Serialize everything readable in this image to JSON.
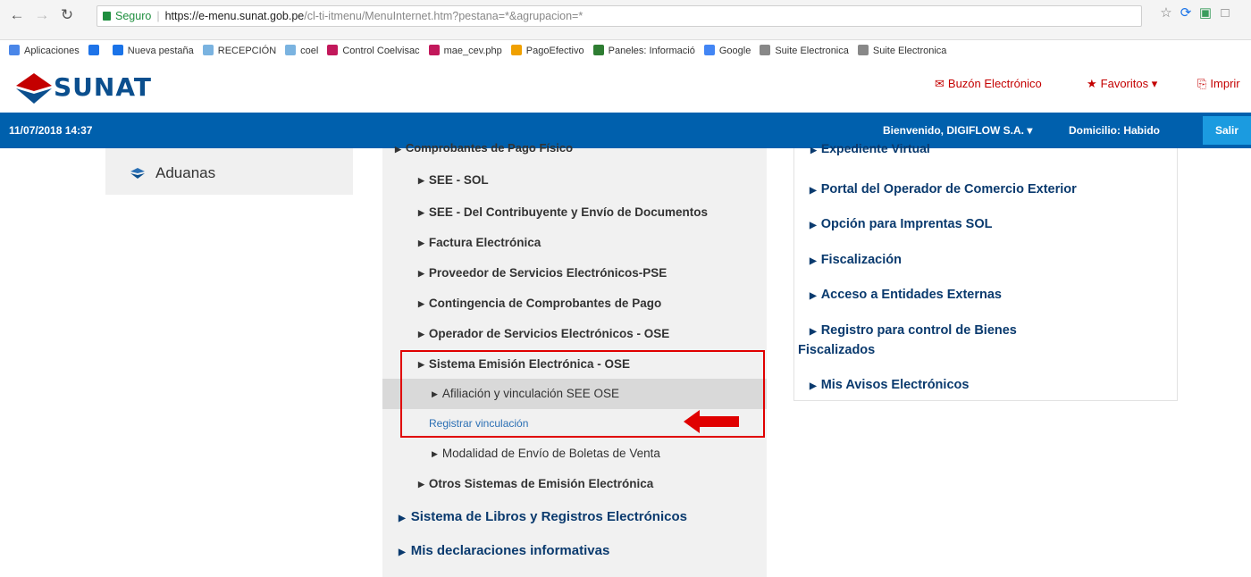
{
  "browser": {
    "secure_label": "Seguro",
    "url_host": "https://e-menu.sunat.gob.pe",
    "url_path": "/cl-ti-itmenu/MenuInternet.htm?pestana=*&agrupacion=*",
    "bookmarks": [
      {
        "label": "Aplicaciones",
        "color": "#4a86e8"
      },
      {
        "label": "",
        "color": "#1e73e8"
      },
      {
        "label": "Nueva pestaña",
        "color": "#1a73e8"
      },
      {
        "label": "RECEPCIÓN",
        "color": "#7ab3e0"
      },
      {
        "label": "coel",
        "color": "#7ab3e0"
      },
      {
        "label": "Control Coelvisac",
        "color": "#c2185b"
      },
      {
        "label": "mae_cev.php",
        "color": "#c2185b"
      },
      {
        "label": "PagoEfectivo",
        "color": "#f0a000"
      },
      {
        "label": "Paneles: Informació",
        "color": "#2e7d32"
      },
      {
        "label": "Google",
        "color": "#4285f4"
      },
      {
        "label": "Suite Electronica",
        "color": "#888888"
      },
      {
        "label": "Suite Electronica",
        "color": "#888888"
      }
    ]
  },
  "header": {
    "logo_text": "SUNAT",
    "links": [
      "Buzón Electrónico",
      "Favoritos",
      "Imprir"
    ]
  },
  "bluebar": {
    "datetime": "11/07/2018 14:37",
    "welcome": "Bienvenido, DIGIFLOW S.A.",
    "domicilio": "Domicilio: Habido",
    "logout": "Salir"
  },
  "left": {
    "aduanas": "Aduanas"
  },
  "middle": {
    "cut_top": "Comprobantes de Pago Físico",
    "items": [
      "SEE - SOL",
      "SEE - Del Contribuyente y Envío de Documentos",
      "Factura Electrónica",
      "Proveedor de Servicios Electrónicos-PSE",
      "Contingencia de Comprobantes de Pago",
      "Operador de Servicios Electrónicos - OSE",
      "Sistema Emisión Electrónica - OSE"
    ],
    "afiliacion": "Afiliación y vinculación SEE OSE",
    "registrar": "Registrar vinculación",
    "modalidad": "Modalidad de Envío de Boletas de Venta",
    "otros": "Otros Sistemas de Emisión Electrónica",
    "libros": "Sistema de Libros y Registros Electrónicos",
    "declaraciones": "Mis declaraciones informativas"
  },
  "right": {
    "cut_top": "Expediente Virtual",
    "items": [
      "Portal del Operador de Comercio Exterior",
      "Opción para Imprentas SOL",
      "Fiscalización",
      "Acceso a Entidades Externas",
      "Registro para control de Bienes Fiscalizados",
      "Mis Avisos Electrónicos"
    ]
  }
}
